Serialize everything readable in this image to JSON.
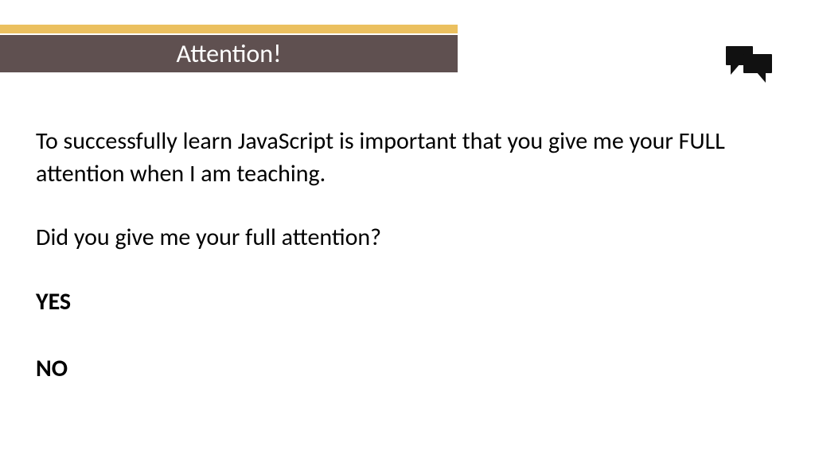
{
  "header": {
    "title": "Attention!"
  },
  "body": {
    "p1": "To successfully learn JavaScript is important that you give me your FULL attention when I am teaching.",
    "p2": "Did you give me your full attention?",
    "option_yes": "YES",
    "option_no": "NO"
  }
}
